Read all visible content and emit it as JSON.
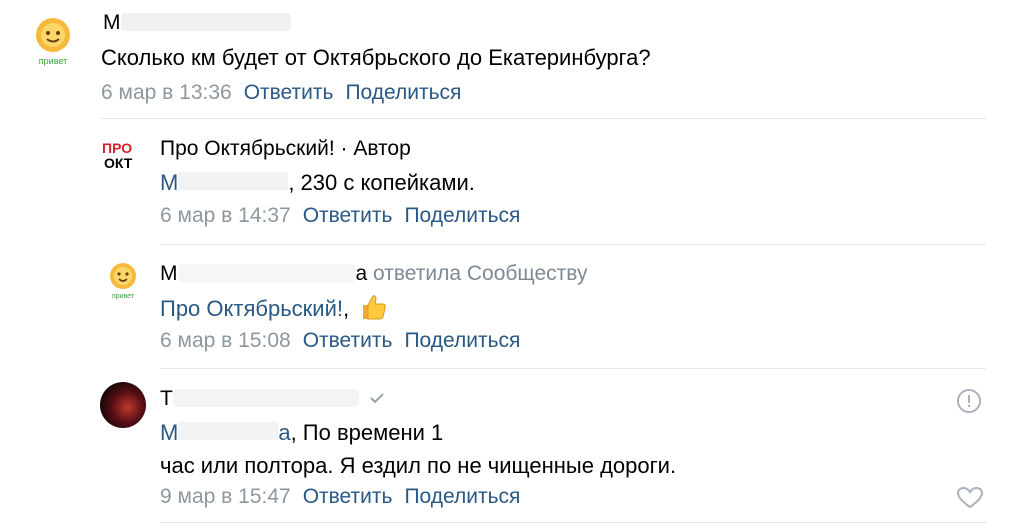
{
  "comments": [
    {
      "author": "М",
      "text": "Сколько км будет от Октябрьского до Екатеринбурга?",
      "time": "6 мар в 13:36",
      "reply_label": "Ответить",
      "share_label": "Поделиться",
      "avatar_caption": "привет"
    },
    {
      "author": "Про Октябрьский!",
      "author_suffix": " · Автор",
      "mention": "М",
      "text": ", 230 с копейками.",
      "time": "6 мар в 14:37",
      "reply_label": "Ответить",
      "share_label": "Поделиться",
      "avatar_logo_line1": "ПРО",
      "avatar_logo_line2": "ОКТ"
    },
    {
      "author": "М",
      "author_tail": "а",
      "author_suffix": " ответила Сообществу",
      "mention": "Про Октябрьский!",
      "text": ",",
      "time": "6 мар в 15:08",
      "reply_label": "Ответить",
      "share_label": "Поделиться",
      "avatar_caption": "привет"
    },
    {
      "author": "Т",
      "mention": "М",
      "mention_tail": "а",
      "text_line1": ", По времени 1",
      "text_line2": "час или полтора. Я ездил по не чищенные дороги.",
      "time": "9 мар в 15:47",
      "reply_label": "Ответить",
      "share_label": "Поделиться"
    }
  ],
  "colors": {
    "link": "#2a5885",
    "meta": "#8e979f",
    "divider": "#e3e5e8"
  },
  "icons": [
    "report-icon",
    "like-heart-icon",
    "thumbs-up-emoji",
    "verified-check-icon"
  ]
}
